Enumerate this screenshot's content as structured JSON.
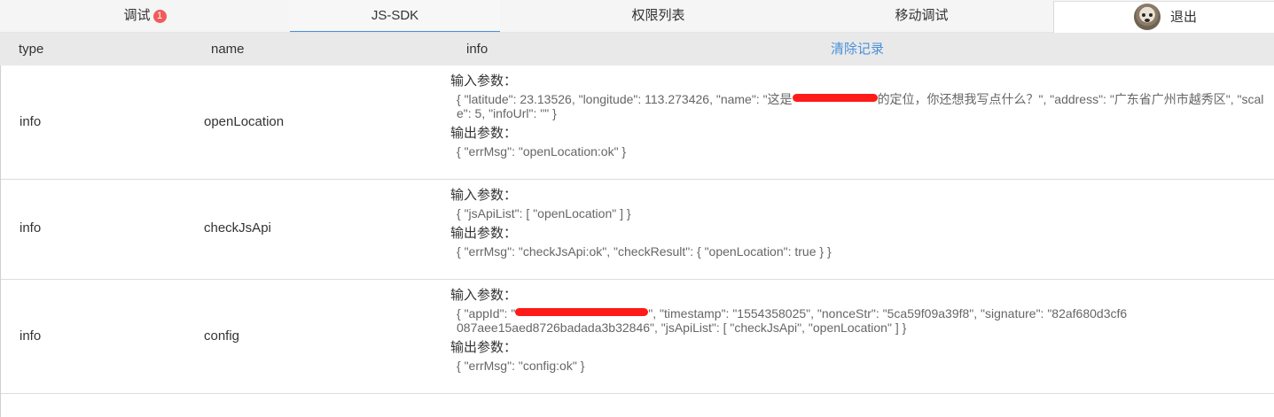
{
  "tabs": [
    {
      "label": "调试",
      "badge": "1"
    },
    {
      "label": "JS-SDK"
    },
    {
      "label": "权限列表"
    },
    {
      "label": "移动调试"
    }
  ],
  "user": {
    "logout_label": "退出",
    "avatar_icon": "avatar-dog-icon"
  },
  "table": {
    "headers": {
      "type": "type",
      "name": "name",
      "info": "info",
      "clear": "清除记录"
    },
    "rows": [
      {
        "type": "info",
        "name": "openLocation",
        "input_label": "输入参数：",
        "input_pre": "{ \"latitude\": 23.13526, \"longitude\": 113.273426, \"name\": \"这是",
        "input_post": "的定位，你还想我写点什么？\", \"address\": \"广东省广州市越秀区\", \"scale\": 5, \"infoUrl\": \"\" }",
        "output_label": "输出参数：",
        "output": "{ \"errMsg\": \"openLocation:ok\" }"
      },
      {
        "type": "info",
        "name": "checkJsApi",
        "input_label": "输入参数：",
        "input": "{ \"jsApiList\": [ \"openLocation\" ] }",
        "output_label": "输出参数：",
        "output": "{ \"errMsg\": \"checkJsApi:ok\", \"checkResult\": { \"openLocation\": true } }"
      },
      {
        "type": "info",
        "name": "config",
        "input_label": "输入参数：",
        "input_pre": "{ \"appId\": \"",
        "input_post": "\", \"timestamp\": \"1554358025\", \"nonceStr\": \"5ca59f09a39f8\", \"signature\": \"82af680d3cf6087aee15aed8726badada3b32846\", \"jsApiList\": [ \"checkJsApi\", \"openLocation\" ] }",
        "output_label": "输出参数：",
        "output": "{ \"errMsg\": \"config:ok\" }"
      }
    ]
  },
  "colors": {
    "accent": "#4a90d9",
    "badge": "#f25b5b",
    "redaction": "#ff1a1a",
    "header_bg": "#e9e9e9"
  }
}
